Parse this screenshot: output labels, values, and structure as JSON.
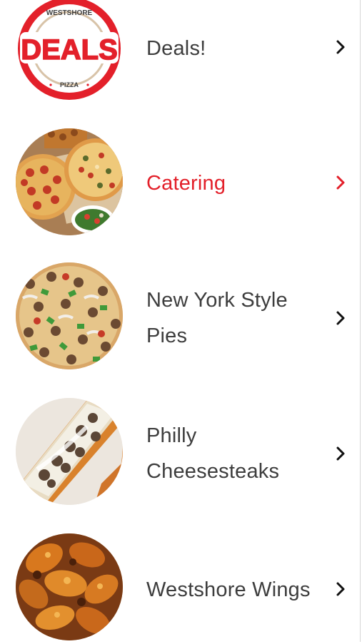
{
  "menu": {
    "items": [
      {
        "label": "Deals!",
        "icon": "deals-logo",
        "active": false
      },
      {
        "label": "Catering",
        "icon": "pizza-platter-photo",
        "active": true
      },
      {
        "label": "New York Style Pies",
        "icon": "pizza-photo",
        "active": false
      },
      {
        "label": "Philly Cheesesteaks",
        "icon": "cheesesteak-photo",
        "active": false
      },
      {
        "label": "Westshore Wings",
        "icon": "wings-photo",
        "active": false
      }
    ],
    "logo": {
      "top_text": "WESTSHORE",
      "main_text": "DEALS",
      "bottom_text": "PIZZA"
    }
  },
  "colors": {
    "accent": "#e3202a",
    "text": "#3d3d3d",
    "chevron": "#111111"
  }
}
